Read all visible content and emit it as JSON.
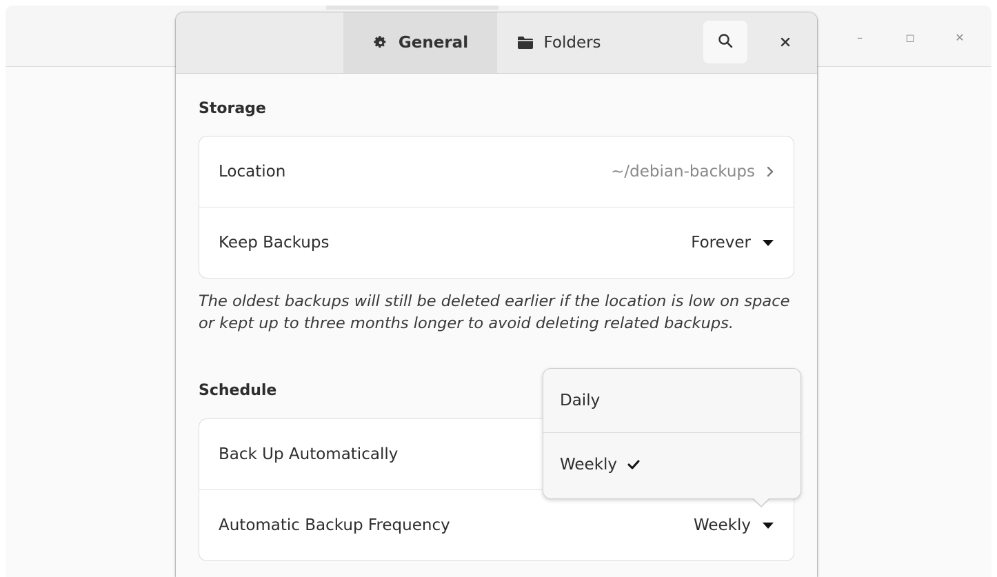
{
  "window_controls": {
    "minimize": "–",
    "maximize": "◻",
    "close": "✕"
  },
  "tabs": [
    {
      "label": "General",
      "icon": "gear-icon",
      "active": true
    },
    {
      "label": "Folders",
      "icon": "folder-icon",
      "active": false
    }
  ],
  "header": {
    "search_icon": "search-icon",
    "close_icon": "close-icon"
  },
  "storage": {
    "title": "Storage",
    "location_label": "Location",
    "location_value": "~/debian-backups",
    "keep_label": "Keep Backups",
    "keep_value": "Forever",
    "note": "The oldest backups will still be deleted earlier if the location is low on space or kept up to three months longer to avoid deleting related backups."
  },
  "schedule": {
    "title": "Schedule",
    "auto_label": "Back Up Automatically",
    "frequency_label": "Automatic Backup Frequency",
    "frequency_value": "Weekly"
  },
  "popover": {
    "options": [
      "Daily",
      "Weekly"
    ],
    "selected": "Weekly"
  },
  "colors": {
    "accent": "#2e2e2e",
    "dim_text": "#8a8a8a"
  }
}
